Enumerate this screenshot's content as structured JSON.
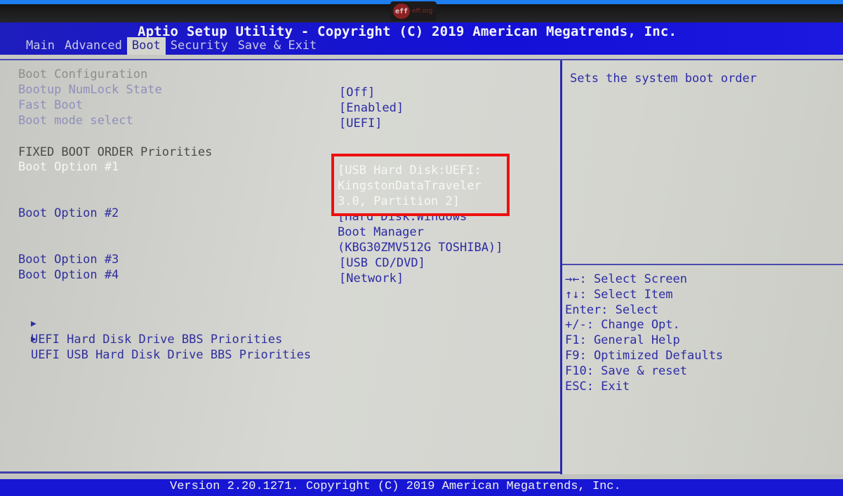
{
  "watermark": {
    "logo": "eff",
    "text": "eff.org"
  },
  "header": {
    "title": "Aptio Setup Utility - Copyright (C) 2019 American Megatrends, Inc.",
    "tabs": [
      {
        "label": "Main",
        "active": false
      },
      {
        "label": "Advanced",
        "active": false
      },
      {
        "label": "Boot",
        "active": true
      },
      {
        "label": "Security",
        "active": false
      },
      {
        "label": "Save & Exit",
        "active": false
      }
    ]
  },
  "settings": {
    "section_boot_config": "Boot Configuration",
    "numlock": {
      "label": "Bootup NumLock State",
      "value": "[Off]"
    },
    "fast_boot": {
      "label": "Fast Boot",
      "value": "[Enabled]"
    },
    "boot_mode": {
      "label": "Boot mode select",
      "value": "[UEFI]"
    },
    "section_fixed": "FIXED BOOT ORDER Priorities",
    "boot_options": [
      {
        "label": "Boot Option #1",
        "value_lines": [
          "[USB Hard Disk:UEFI:",
          "KingstonDataTraveler",
          "3.0, Partition 2]"
        ],
        "selected": true
      },
      {
        "label": "Boot Option #2",
        "value_lines": [
          "[Hard Disk:Windows",
          "Boot Manager",
          "(KBG30ZMV512G TOSHIBA)]"
        ],
        "selected": false
      },
      {
        "label": "Boot Option #3",
        "value_lines": [
          "[USB CD/DVD]"
        ],
        "selected": false
      },
      {
        "label": "Boot Option #4",
        "value_lines": [
          "[Network]"
        ],
        "selected": false
      }
    ],
    "submenus": [
      {
        "arrow": "▶",
        "label": "UEFI Hard Disk Drive BBS Priorities"
      },
      {
        "arrow": "▶",
        "label": "UEFI USB Hard Disk Drive BBS Priorities"
      }
    ]
  },
  "help": {
    "description": "Sets the system boot order",
    "keys": [
      "→←: Select Screen",
      "↑↓: Select Item",
      "Enter: Select",
      "+/-: Change Opt.",
      "F1: General Help",
      "F9: Optimized Defaults",
      "F10: Save & reset",
      "ESC: Exit"
    ]
  },
  "footer": {
    "text": "Version 2.20.1271. Copyright (C) 2019 American Megatrends, Inc."
  },
  "colors": {
    "header_blue": "#1410d8",
    "panel_gray": "#d4d5cf",
    "text_blue": "#2c2ca6",
    "highlight_red": "#ee1010"
  }
}
